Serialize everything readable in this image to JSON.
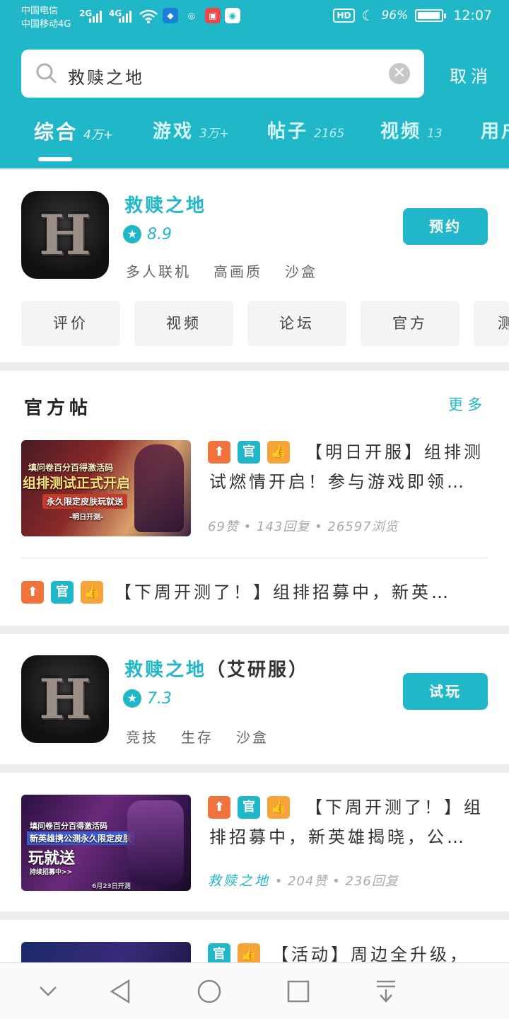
{
  "status_bar": {
    "carrier1": "中国电信",
    "carrier2": "中国移动4G",
    "signal1": "2G",
    "signal2": "4G",
    "hd": "HD",
    "battery": "96%",
    "battery_level": 0.96,
    "time": "12:07"
  },
  "search": {
    "query": "救赎之地",
    "cancel_label": "取消"
  },
  "tabs": [
    {
      "label": "综合",
      "count": "4万+"
    },
    {
      "label": "游戏",
      "count": "3万+"
    },
    {
      "label": "帖子",
      "count": "2165"
    },
    {
      "label": "视频",
      "count": "13"
    },
    {
      "label": "用户",
      "count": ""
    }
  ],
  "game1": {
    "name": "救赎之地",
    "rating": "8.9",
    "tags": [
      "多人联机",
      "高画质",
      "沙盒"
    ],
    "action": "预约",
    "chips": [
      "评价",
      "视频",
      "论坛",
      "官方",
      "测"
    ]
  },
  "official_posts": {
    "title": "官方帖",
    "more": "更多",
    "post1": {
      "title": "【明日开服】组排测试燃情开启！参与游戏即领…",
      "meta": "69赞 • 143回复 • 26597浏览",
      "thumb_lines": [
        "填问卷百分百得激活码",
        "组排测试正式开启",
        "永久限定皮肤玩就送",
        "-明日开测-"
      ]
    },
    "post2": {
      "title": "【下周开测了！】组排招募中，新英…"
    }
  },
  "game2": {
    "name": "救赎之地",
    "suffix": "（艾研服）",
    "rating": "7.3",
    "tags": [
      "竞技",
      "生存",
      "沙盒"
    ],
    "action": "试玩"
  },
  "post3": {
    "title": "【下周开测了！】组排招募中，新英雄揭晓，公…",
    "game": "救赎之地",
    "meta": "• 204赞 • 236回复",
    "thumb_lines": [
      "填问卷百分百得激活码",
      "新英雄携公测永久限定皮肤",
      "玩就送",
      "持续招募中>>",
      "6月23日开测"
    ]
  },
  "post4": {
    "title": "【活动】周边全升级，"
  },
  "badges": {
    "up": "⬆",
    "official": "官",
    "like": "👍"
  }
}
